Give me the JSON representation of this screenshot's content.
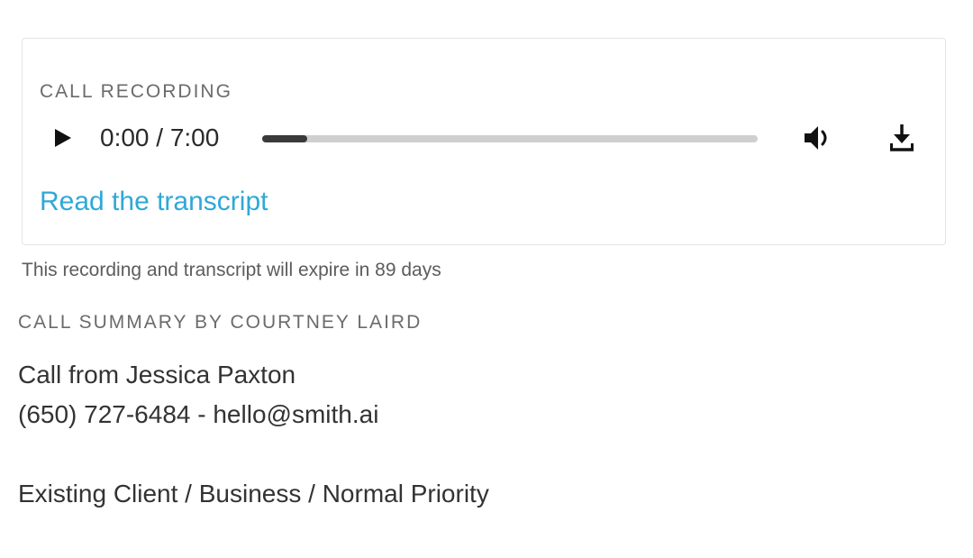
{
  "recording": {
    "label": "CALL RECORDING",
    "time_display": "0:00 / 7:00",
    "progress_fraction": 0.09,
    "transcript_link": "Read the transcript",
    "icons": {
      "play": "play-icon",
      "volume": "volume-icon",
      "download": "download-icon"
    }
  },
  "expire_note": "This recording and transcript will expire in 89 days",
  "summary": {
    "label": "CALL SUMMARY BY COURTNEY LAIRD",
    "caller_line": "Call from Jessica Paxton",
    "contact_line": "(650) 727-6484 - hello@smith.ai",
    "category_line": "Existing Client / Business / Normal Priority"
  },
  "colors": {
    "link": "#2fa8d8",
    "progress_track": "#cfcfcf",
    "progress_fill": "#3a3a3a"
  }
}
